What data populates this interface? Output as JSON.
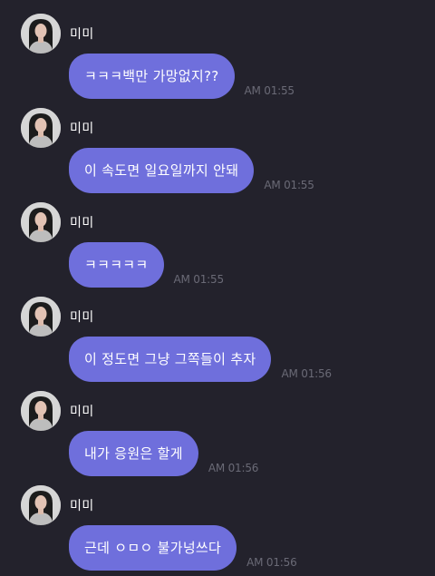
{
  "messages": [
    {
      "sender": "미미",
      "text": "ㅋㅋㅋ백만 가망없지??",
      "time": "AM 01:55"
    },
    {
      "sender": "미미",
      "text": "이 속도면 일요일까지 안돼",
      "time": "AM 01:55"
    },
    {
      "sender": "미미",
      "text": "ㅋㅋㅋㅋㅋ",
      "time": "AM 01:55"
    },
    {
      "sender": "미미",
      "text": "이 정도면 그냥 그쪽들이 추자",
      "time": "AM 01:56"
    },
    {
      "sender": "미미",
      "text": "내가 응원은 할게",
      "time": "AM 01:56"
    },
    {
      "sender": "미미",
      "text": "근데 ㅇㅁㅇ 불가넝쓰다",
      "time": "AM 01:56"
    }
  ],
  "theme": {
    "background": "#23222c",
    "bubble": "#6f6fdc",
    "timestamp": "#6a6a76"
  }
}
